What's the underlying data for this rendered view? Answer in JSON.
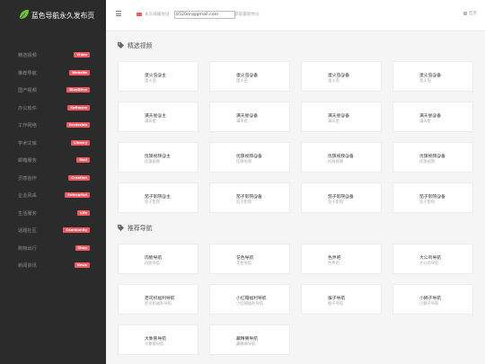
{
  "brand": {
    "title": "蓝色导航永久发布页"
  },
  "sidebar": {
    "items": [
      {
        "label": "精选视频",
        "badge": "Video"
      },
      {
        "label": "推荐导航",
        "badge": "Website"
      },
      {
        "label": "国产视频",
        "badge": "BlueDlive"
      },
      {
        "label": "办公软件",
        "badge": "Software"
      },
      {
        "label": "工作网络",
        "badge": "Excession"
      },
      {
        "label": "学术文库",
        "badge": "Library"
      },
      {
        "label": "邮箱服务",
        "badge": "Mail"
      },
      {
        "label": "灵感创作",
        "badge": "Creation"
      },
      {
        "label": "企业风采",
        "badge": "Enterprise"
      },
      {
        "label": "生活服务",
        "badge": "Life"
      },
      {
        "label": "话题社区",
        "badge": "Community"
      },
      {
        "label": "购物出行",
        "badge": "Shop"
      },
      {
        "label": "新闻资讯",
        "badge": "News"
      }
    ]
  },
  "topbar": {
    "mail_prefix": "永久邮箱地址",
    "email_value": "b520nn@gmail.com",
    "mail_suffix": "获取最新地址",
    "home_label": "首页"
  },
  "sections": [
    {
      "title": "精选视频",
      "rows": [
        [
          {
            "title": "蛋火虫@主",
            "sub": "蛋火虫"
          },
          {
            "title": "蛋火虫@备",
            "sub": "蛋火虫"
          },
          {
            "title": "蛋火虫@备",
            "sub": "蛋火虫"
          },
          {
            "title": "蛋火虫@备",
            "sub": "蛋火虫"
          }
        ],
        [
          {
            "title": "满天星@主",
            "sub": "满天星"
          },
          {
            "title": "满天星@备",
            "sub": "满天星"
          },
          {
            "title": "满天星@备",
            "sub": "满天星"
          },
          {
            "title": "满天星@备",
            "sub": "满天星"
          }
        ],
        [
          {
            "title": "优旗视频@主",
            "sub": "优旗视频"
          },
          {
            "title": "优旗视频@备",
            "sub": "优旗视频"
          },
          {
            "title": "优旗视频@备",
            "sub": "优旗视频"
          },
          {
            "title": "优旗视频@备",
            "sub": "优旗视频"
          }
        ],
        [
          {
            "title": "茄子影院@主",
            "sub": "茄子影院"
          },
          {
            "title": "茄子影院@备",
            "sub": "茄子影院"
          },
          {
            "title": "茄子影院@备",
            "sub": "茄子影院"
          },
          {
            "title": "茄子影院@备",
            "sub": "茄子影院"
          }
        ]
      ]
    },
    {
      "title": "推荐导航",
      "rows": [
        [
          {
            "title": "肉鲍导航",
            "sub": "肉鲍导航"
          },
          {
            "title": "花色导航",
            "sub": "花色导航"
          },
          {
            "title": "色界吧",
            "sub": "色界吧"
          },
          {
            "title": "大公鸡导航",
            "sub": "大公鸡导航"
          }
        ],
        [
          {
            "title": "老司机福利导航",
            "sub": "老司机福利导航"
          },
          {
            "title": "小红帽福利导航",
            "sub": "小红帽福利导航"
          },
          {
            "title": "猴子导航",
            "sub": "猴子导航"
          },
          {
            "title": "小狮子导航",
            "sub": "小狮子导航"
          }
        ],
        [
          {
            "title": "大象蕉导航",
            "sub": "大象蕉导航"
          },
          {
            "title": "藏精阁导航",
            "sub": "藏精阁导航"
          }
        ]
      ]
    }
  ],
  "colors": {
    "sidebar_bg": "#2b2b2b",
    "badge": "#ef5a63",
    "leaf": "#6fc63a",
    "page_bg": "#f5f5f5"
  }
}
